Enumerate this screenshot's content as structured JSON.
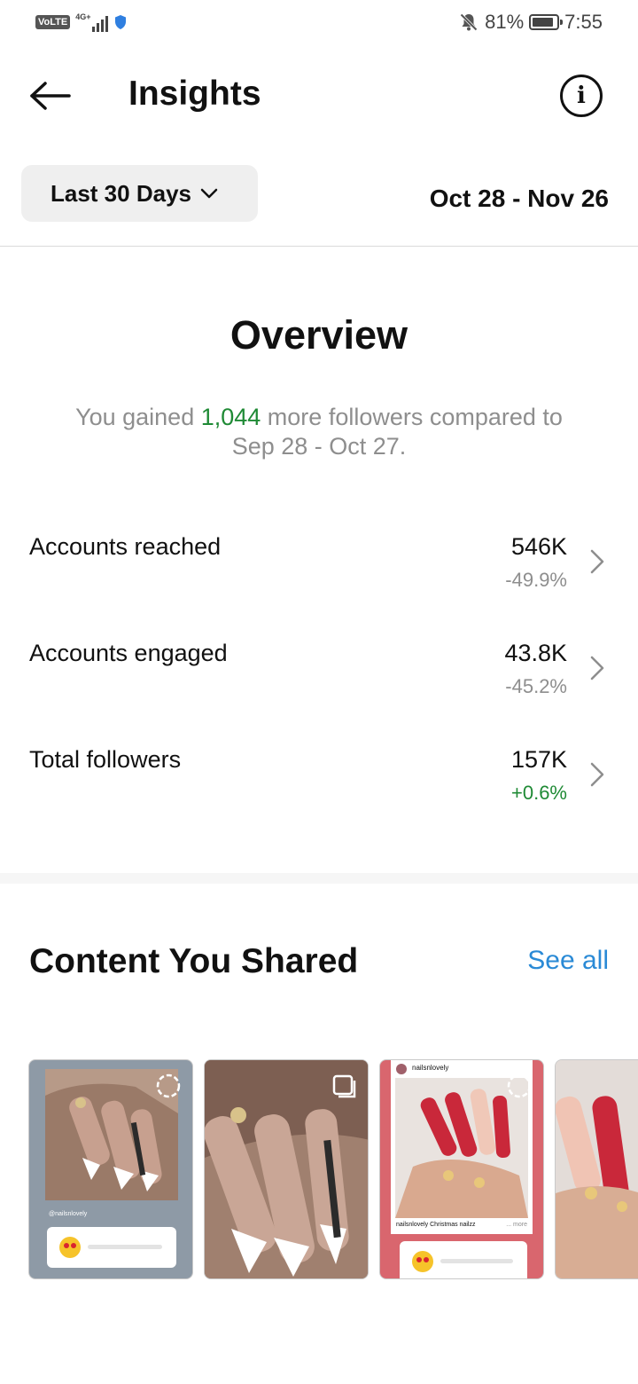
{
  "status_bar": {
    "volte": "VoLTE",
    "network": "4G+",
    "battery": "81%",
    "time": "7:55"
  },
  "header": {
    "title": "Insights"
  },
  "filter": {
    "range_label": "Last 30 Days",
    "date_range": "Oct 28 - Nov 26"
  },
  "overview": {
    "title": "Overview",
    "subtitle_pre": "You gained ",
    "subtitle_count": "1,044",
    "subtitle_post": " more followers compared to Sep 28 - Oct 27."
  },
  "metrics": [
    {
      "label": "Accounts reached",
      "value": "546K",
      "change": "-49.9%"
    },
    {
      "label": "Accounts engaged",
      "value": "43.8K",
      "change": "-45.2%"
    },
    {
      "label": "Total followers",
      "value": "157K",
      "change": "+0.6%"
    }
  ],
  "content": {
    "title": "Content You Shared",
    "see_all": "See all",
    "posts": [
      {
        "handle": "@nailsnlovely"
      },
      {
        "handle": ""
      },
      {
        "handle": "nailsnlovely",
        "caption": "nailsnlovely Christmas nailzz",
        "more": "... more"
      },
      {
        "handle": ""
      }
    ]
  },
  "colors": {
    "positive": "#1f8a35",
    "link": "#2a8ad6",
    "muted": "#8e8e8e"
  }
}
